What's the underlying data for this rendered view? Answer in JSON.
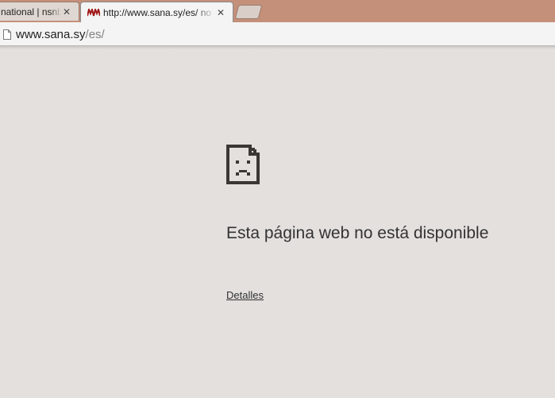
{
  "tabs": [
    {
      "title": "national | nsnbc",
      "active": false
    },
    {
      "title": "http://www.sana.sy/es/ no disponible",
      "active": true
    }
  ],
  "address_bar": {
    "domain": "www.sana.sy",
    "path": "/es/"
  },
  "error_page": {
    "icon": "sad-document-icon",
    "title": "Esta página web no está disponible",
    "details_link": "Detalles"
  },
  "colors": {
    "tabstrip": "#c5907a",
    "page_background": "#e3e0de",
    "favicon": "#a01818"
  }
}
